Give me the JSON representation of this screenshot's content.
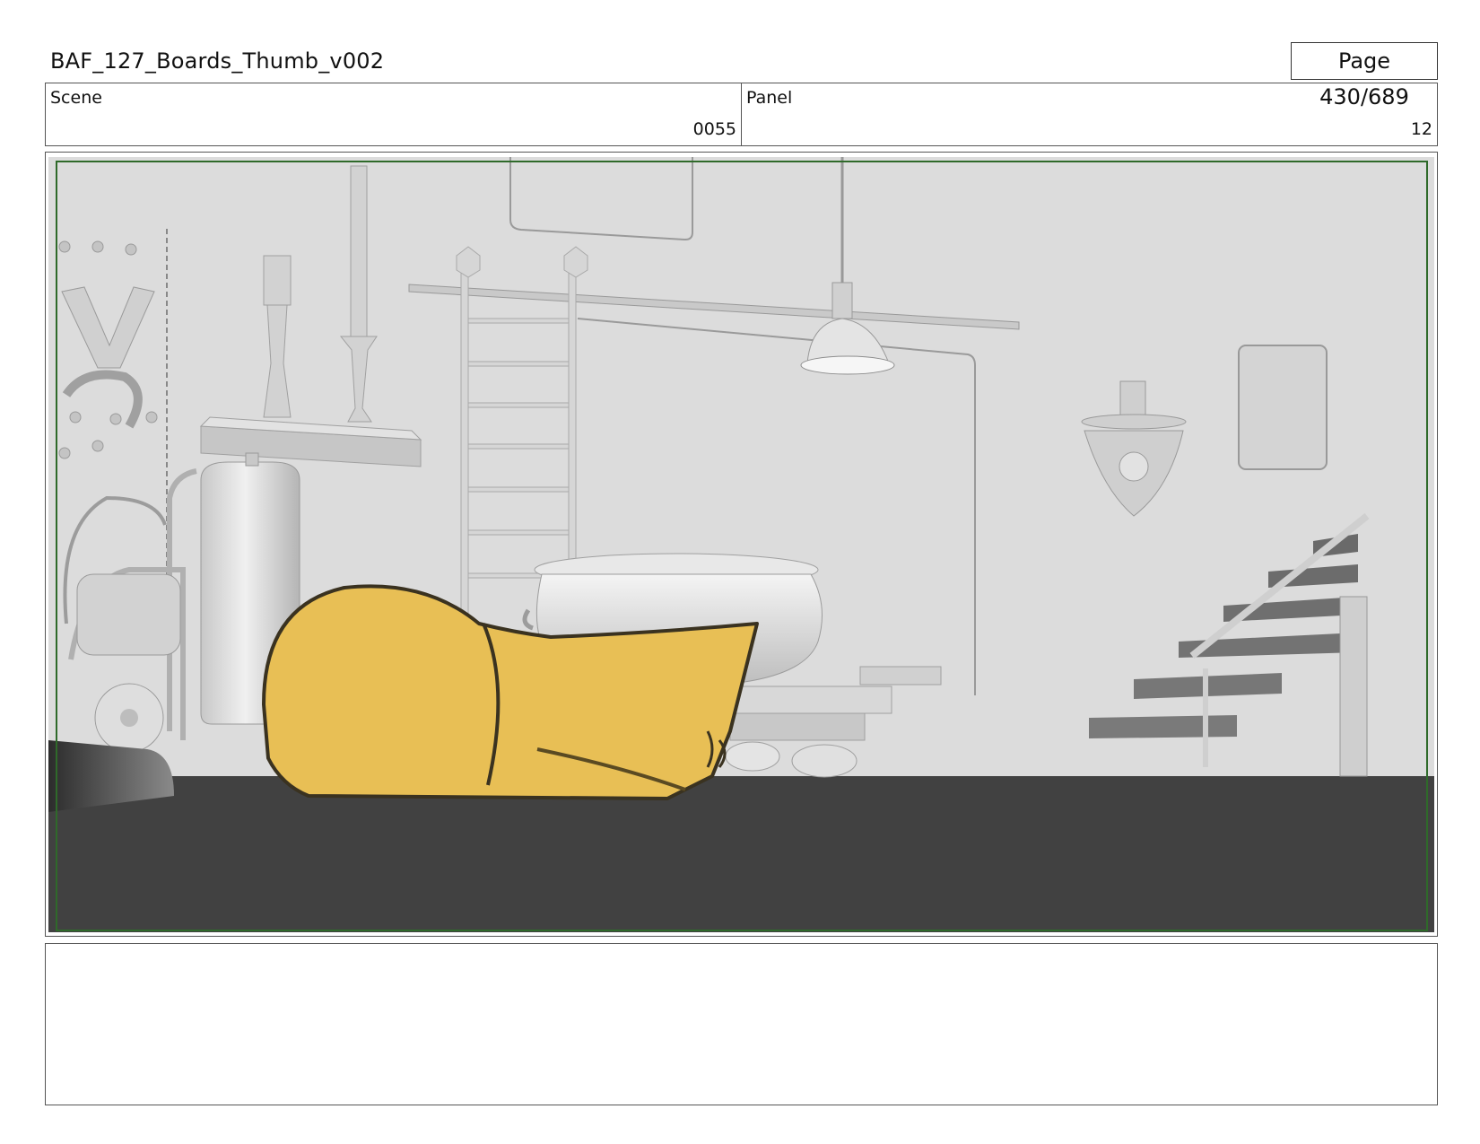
{
  "header": {
    "title": "BAF_127_Boards_Thumb_v002",
    "page": "Page 430/689"
  },
  "info": {
    "scene_label": "Scene",
    "scene_value": "0055",
    "panel_label": "Panel",
    "panel_value": "12"
  },
  "panel": {
    "image_description": "Storyboard panel: grey 3D render of a workshop interior with ladder, candlesticks, cauldron, pendant lamp and stairs; yellow sketched character in foreground",
    "safe_frame_color": "#2f6a2a",
    "sketch_color": "#e8bf55",
    "floor_color": "#414141",
    "wall_color": "#dcdcdc"
  },
  "notes": {
    "text": ""
  }
}
